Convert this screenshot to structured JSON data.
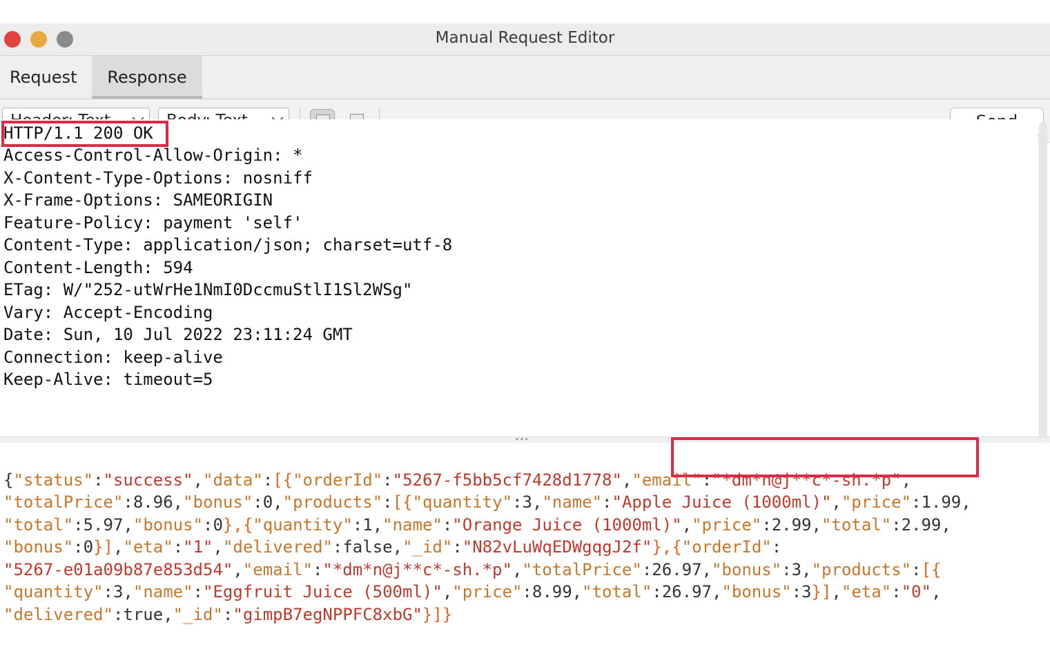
{
  "window": {
    "title": "Manual Request Editor"
  },
  "tabs": [
    {
      "label": "Request"
    },
    {
      "label": "Response"
    }
  ],
  "toolbar": {
    "header_select": "Header: Text",
    "body_select": "Body: Text",
    "send_label": "Send"
  },
  "response_headers": [
    "HTTP/1.1 200 OK",
    "Access-Control-Allow-Origin: *",
    "X-Content-Type-Options: nosniff",
    "X-Frame-Options: SAMEORIGIN",
    "Feature-Policy: payment 'self'",
    "Content-Type: application/json; charset=utf-8",
    "Content-Length: 594",
    "ETag: W/\"252-utWrHe1NmI0DccmuStlI1Sl2WSg\"",
    "Vary: Accept-Encoding",
    "Date: Sun, 10 Jul 2022 23:11:24 GMT",
    "Connection: keep-alive",
    "Keep-Alive: timeout=5"
  ],
  "response_body": {
    "punct": {
      "ob": "{",
      "cb": "}",
      "obk": "[",
      "cbk": "]",
      "q": "\"",
      "c": ":",
      "cm": ",",
      "obobk": "[{",
      "cbcm": "},",
      "cbcmob": "},{",
      "cbkcm": "],",
      "cbcbk": "}]",
      "cbcbkcb": "}]}"
    },
    "keys": {
      "status": "status",
      "data": "data",
      "orderId": "orderId",
      "email": "email",
      "totalPrice": "totalPrice",
      "bonus": "bonus",
      "products": "products",
      "quantity": "quantity",
      "name": "name",
      "price": "price",
      "total": "total",
      "eta": "eta",
      "delivered": "delivered",
      "_id": "_id"
    },
    "values": {
      "success": "success",
      "order1_id": "5267-f5bb5cf7428d1778",
      "email": "*dm*n@j**c*-sh.*p",
      "order1_totalPrice": "8.96",
      "order1_bonus": "0",
      "p1_quantity": "3",
      "p1_name": "Apple Juice (1000ml)",
      "p1_price": "1.99",
      "p1_total": "5.97",
      "p1_bonus": "0",
      "p2_quantity": "1",
      "p2_name": "Orange Juice (1000ml)",
      "p2_price": "2.99",
      "p2_total": "2.99",
      "p2_bonus": "0",
      "order1_eta": "1",
      "order1_delivered": "false",
      "order1_id2": "N82vLuWqEDWgqgJ2f",
      "order2_id": "5267-e01a09b87e853d54",
      "order2_totalPrice": "26.97",
      "order2_bonus": "3",
      "p3_quantity": "3",
      "p3_name": "Eggfruit Juice (500ml)",
      "p3_price": "8.99",
      "p3_total": "26.97",
      "p3_bonus": "3",
      "order2_eta": "0",
      "order2_delivered": "true",
      "order2_id2": "gimpB7egNPPFC8xbG"
    }
  }
}
